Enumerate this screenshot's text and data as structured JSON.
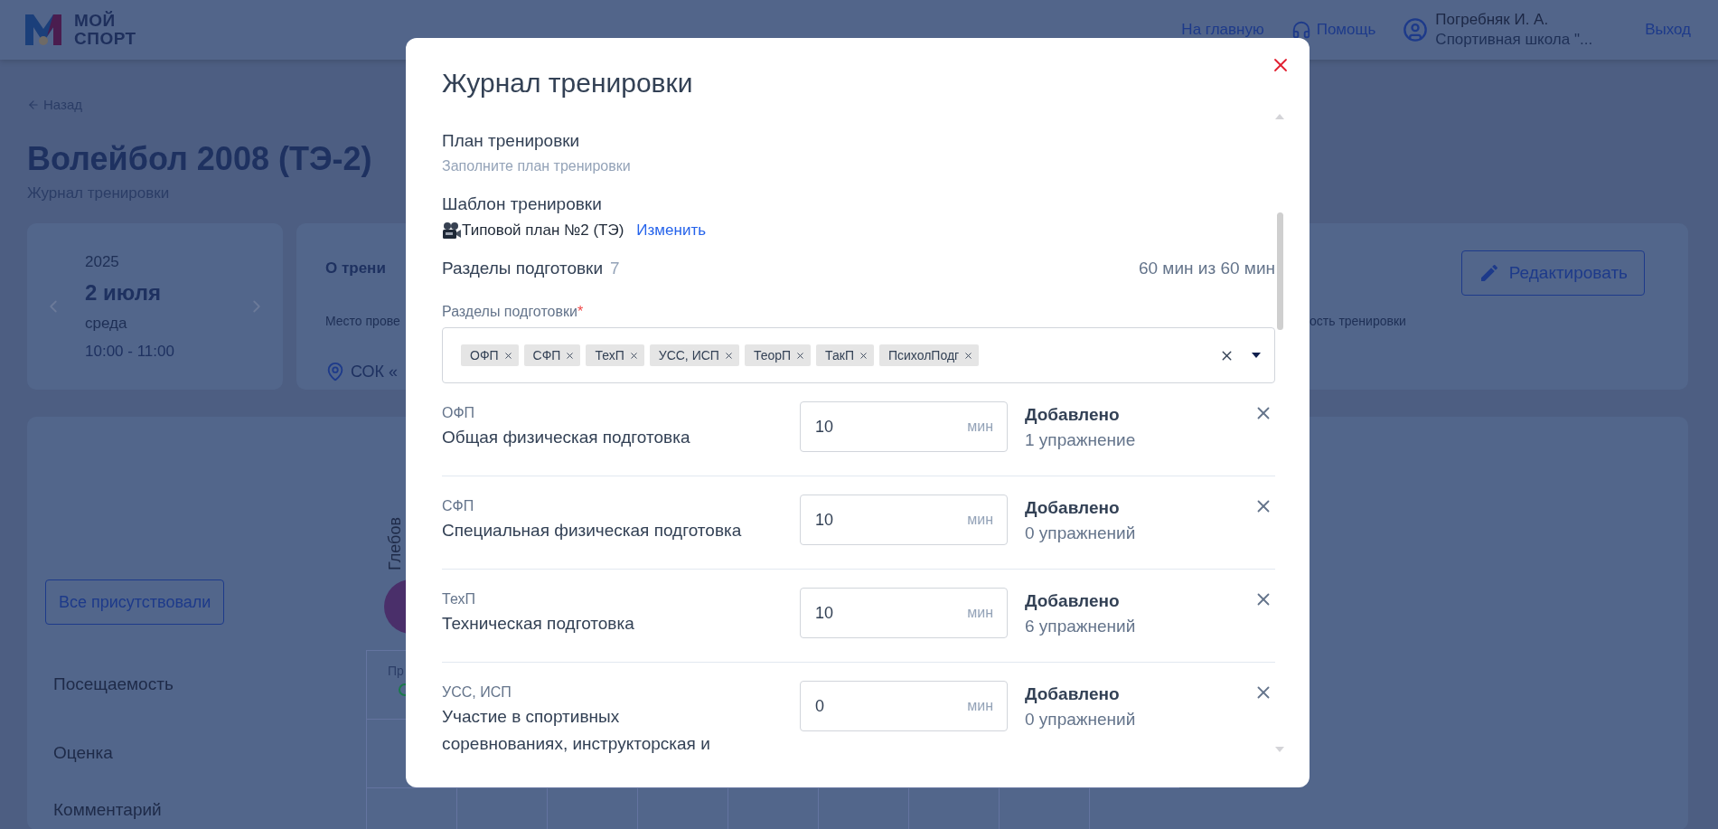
{
  "header": {
    "logo_text": [
      "МОЙ",
      "СПОРТ"
    ],
    "nav": [
      {
        "kind": "link",
        "label": "На главную"
      },
      {
        "kind": "help",
        "label": "Помощь"
      }
    ],
    "user": {
      "name": "Погребняк И. А.",
      "org": "Спортивная школа \"..."
    },
    "logout": "Выход"
  },
  "page": {
    "back": "Назад",
    "title": "Волейбол 2008 (ТЭ-2)",
    "subtitle": "Журнал тренировки"
  },
  "date_card": {
    "year": "2025",
    "date": "2 июля",
    "weekday": "среда",
    "time": "10:00 - 11:00"
  },
  "info_card": {
    "title": "О трени",
    "place_label": "Место прове",
    "place": "СОК «",
    "duration_label": "ость тренировки",
    "edit_button": "Редактировать"
  },
  "attendance": {
    "all_button": "Все присутствовали",
    "athlete": "Глебов",
    "status_label": "Пр",
    "rows": [
      "Посещаемость",
      "Оценка",
      "Комментарий"
    ]
  },
  "modal": {
    "title": "Журнал тренировки",
    "plan": {
      "title": "План тренировки",
      "hint": "Заполните план тренировки"
    },
    "template": {
      "title": "Шаблон тренировки",
      "name": "Типовой план №2 (ТЭ)",
      "change": "Изменить"
    },
    "sections": {
      "title": "Разделы подготовки",
      "count": "7",
      "total": "60 мин из 60 мин"
    },
    "select": {
      "label": "Разделы подготовки",
      "required_mark": "*",
      "tags": [
        "ОФП",
        "СФП",
        "ТехП",
        "УСС, ИСП",
        "ТеорП",
        "ТакП",
        "ПсихолПодг"
      ]
    },
    "rows": [
      {
        "code": "ОФП",
        "name": "Общая физическая подготовка",
        "minutes": "10",
        "unit": "мин",
        "added": "Добавлено",
        "count": "1 упражнение"
      },
      {
        "code": "СФП",
        "name": "Специальная физическая подготовка",
        "minutes": "10",
        "unit": "мин",
        "added": "Добавлено",
        "count": "0 упражнений"
      },
      {
        "code": "ТехП",
        "name": "Техническая подготовка",
        "minutes": "10",
        "unit": "мин",
        "added": "Добавлено",
        "count": "6 упражнений"
      },
      {
        "code": "УСС, ИСП",
        "name": "Участие в спортивных соревнованиях, инструкторская и",
        "minutes": "0",
        "unit": "мин",
        "added": "Добавлено",
        "count": "0 упражнений"
      }
    ]
  }
}
